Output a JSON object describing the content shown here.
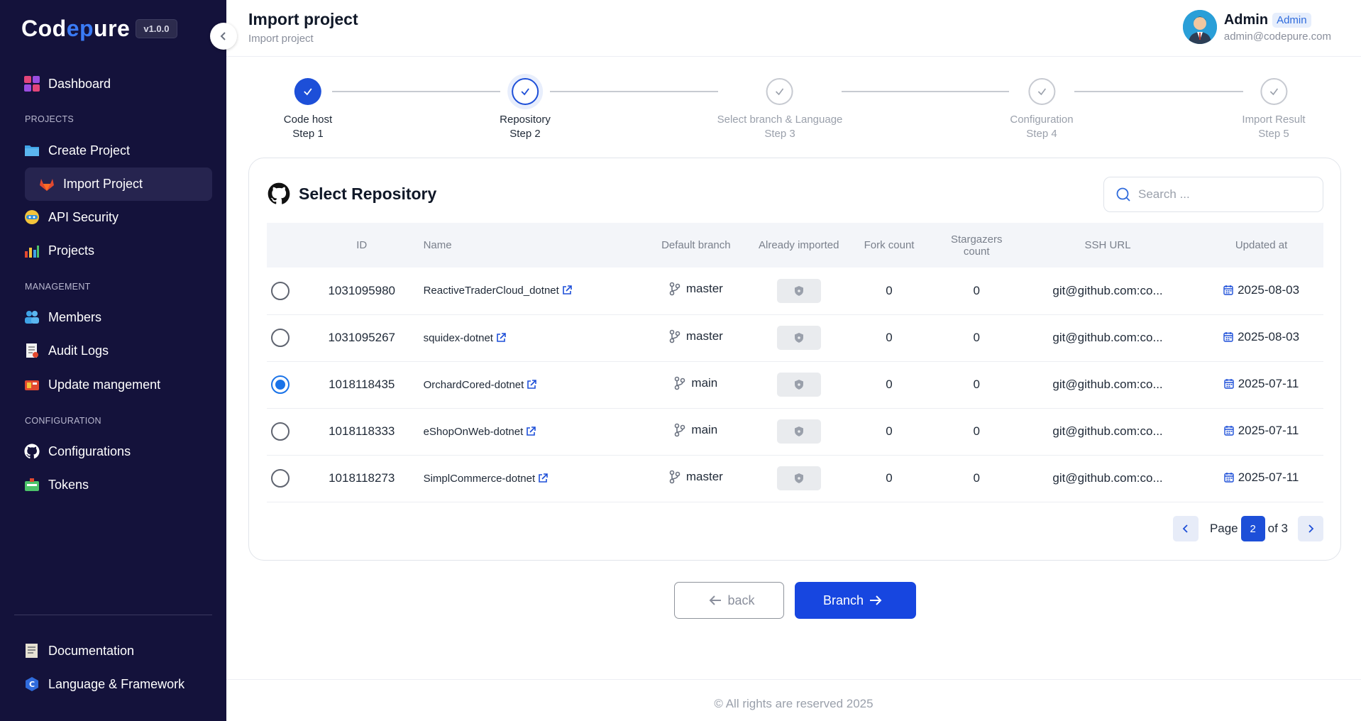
{
  "app": {
    "logo_prefix": "Cod",
    "logo_accent": "ep",
    "logo_suffix": "ure",
    "version": "v1.0.0"
  },
  "sidebar": {
    "dashboard": "Dashboard",
    "section_projects": "PROJECTS",
    "create_project": "Create Project",
    "import_project": "Import Project",
    "api_security": "API Security",
    "projects": "Projects",
    "section_management": "MANAGEMENT",
    "members": "Members",
    "audit_logs": "Audit Logs",
    "update_management": "Update mangement",
    "section_configuration": "CONFIGURATION",
    "configurations": "Configurations",
    "tokens": "Tokens",
    "documentation": "Documentation",
    "language_framework": "Language & Framework"
  },
  "header": {
    "title": "Import project",
    "breadcrumb": "Import project",
    "user_name": "Admin",
    "user_role": "Admin",
    "user_email": "admin@codepure.com"
  },
  "steps": [
    {
      "label": "Code host",
      "sub": "Step 1",
      "state": "done"
    },
    {
      "label": "Repository",
      "sub": "Step 2",
      "state": "current"
    },
    {
      "label": "Select branch & Language",
      "sub": "Step 3",
      "state": "todo"
    },
    {
      "label": "Configuration",
      "sub": "Step 4",
      "state": "todo"
    },
    {
      "label": "Import Result",
      "sub": "Step 5",
      "state": "todo"
    }
  ],
  "card": {
    "title": "Select Repository",
    "search_placeholder": "Search ..."
  },
  "table": {
    "columns": [
      "ID",
      "Name",
      "Default branch",
      "Already imported",
      "Fork count",
      "Stargazers count",
      "SSH URL",
      "Updated at"
    ],
    "rows": [
      {
        "id": "1031095980",
        "name": "ReactiveTraderCloud_dotnet",
        "branch": "master",
        "forks": "0",
        "stars": "0",
        "ssh": "git@github.com:co...",
        "updated": "2025-08-03",
        "selected": false
      },
      {
        "id": "1031095267",
        "name": "squidex-dotnet",
        "branch": "master",
        "forks": "0",
        "stars": "0",
        "ssh": "git@github.com:co...",
        "updated": "2025-08-03",
        "selected": false
      },
      {
        "id": "1018118435",
        "name": "OrchardCored-dotnet",
        "branch": "main",
        "forks": "0",
        "stars": "0",
        "ssh": "git@github.com:co...",
        "updated": "2025-07-11",
        "selected": true
      },
      {
        "id": "1018118333",
        "name": "eShopOnWeb-dotnet",
        "branch": "main",
        "forks": "0",
        "stars": "0",
        "ssh": "git@github.com:co...",
        "updated": "2025-07-11",
        "selected": false
      },
      {
        "id": "1018118273",
        "name": "SimplCommerce-dotnet",
        "branch": "master",
        "forks": "0",
        "stars": "0",
        "ssh": "git@github.com:co...",
        "updated": "2025-07-11",
        "selected": false
      }
    ]
  },
  "pagination": {
    "page_label": "Page",
    "current": "2",
    "of_label": "of 3"
  },
  "actions": {
    "back": "back",
    "next": "Branch"
  },
  "footer": {
    "text": "© All rights are reserved 2025"
  },
  "colors": {
    "sidebar_bg": "#14123b",
    "primary": "#1d4fd8",
    "radio_selected": "#1a73e8"
  }
}
